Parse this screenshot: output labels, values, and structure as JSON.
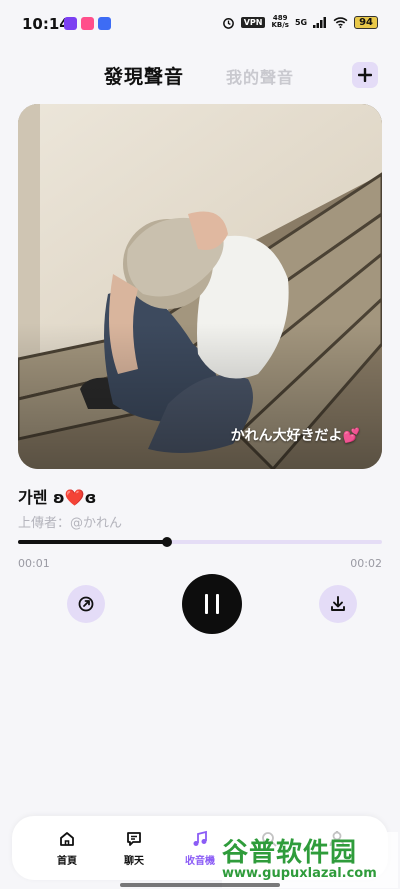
{
  "status_bar": {
    "time": "10:14",
    "vpn": "VPN",
    "net_speed_value": "489",
    "net_speed_unit": "KB/s",
    "signal": "5G",
    "battery": "94",
    "app_icon_colors": [
      "#7b3ff2",
      "#ff4f8b",
      "#3d6cf5"
    ]
  },
  "header": {
    "tab_discover": "發現聲音",
    "tab_mine": "我的聲音",
    "add_icon": "plus-icon"
  },
  "card": {
    "caption": "かれん大好きだよ💕"
  },
  "track": {
    "title": "가렌 ʚ❤️ɞ",
    "uploader": "上傳者：@かれん"
  },
  "player": {
    "current_time": "00:01",
    "total_time": "00:02",
    "progress": 0.41,
    "share_icon": "share-icon",
    "pause_icon": "pause-icon",
    "download_icon": "download-icon"
  },
  "nav": {
    "items": [
      {
        "label": "首頁",
        "icon": "home-icon"
      },
      {
        "label": "聊天",
        "icon": "chat-icon"
      },
      {
        "label": "收音機",
        "icon": "music-note-icon",
        "active": true
      },
      {
        "label": "",
        "icon": "search-icon"
      },
      {
        "label": "",
        "icon": "profile-icon"
      }
    ]
  },
  "watermark": {
    "title": "谷普软件园",
    "url": "www.gupuxlazal.com"
  },
  "colors": {
    "accent": "#8b5cf6",
    "accent_light": "#e4dcf7",
    "background": "#f6f6f9"
  }
}
